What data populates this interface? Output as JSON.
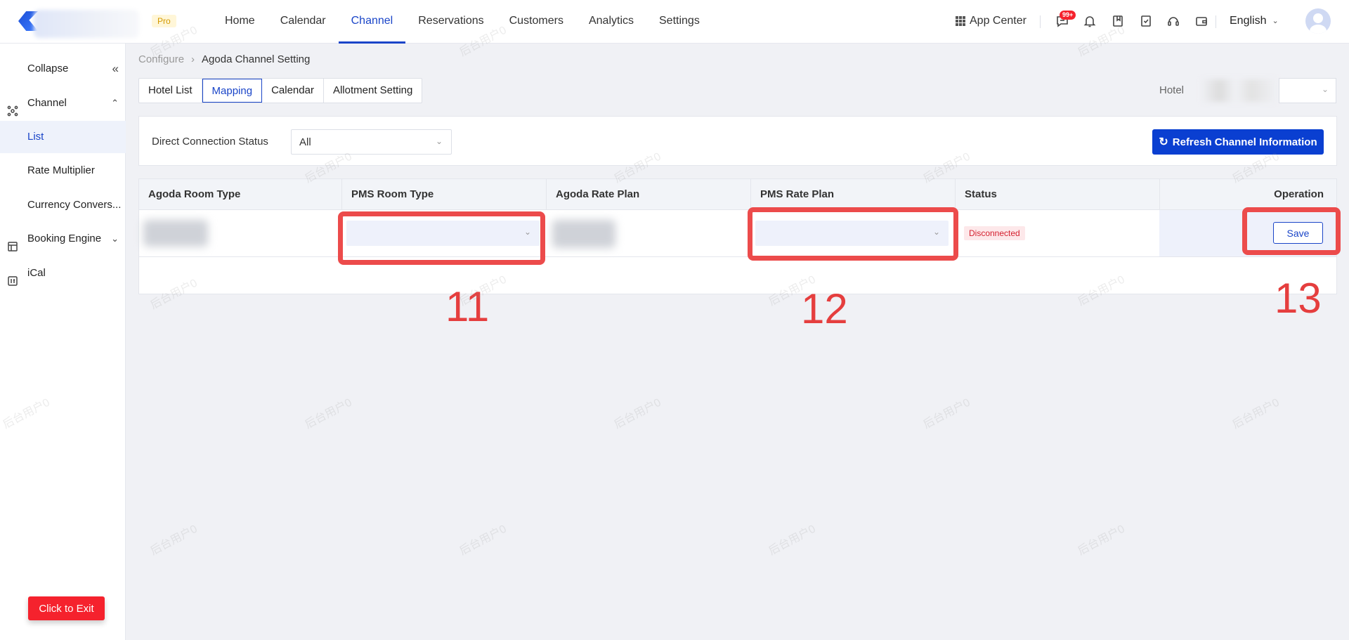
{
  "header": {
    "plan_badge": "Pro",
    "nav": [
      {
        "label": "Home",
        "name": "nav-home",
        "active": false
      },
      {
        "label": "Calendar",
        "name": "nav-calendar",
        "active": false
      },
      {
        "label": "Channel",
        "name": "nav-channel",
        "active": true
      },
      {
        "label": "Reservations",
        "name": "nav-reservations",
        "active": false
      },
      {
        "label": "Customers",
        "name": "nav-customers",
        "active": false
      },
      {
        "label": "Analytics",
        "name": "nav-analytics",
        "active": false
      },
      {
        "label": "Settings",
        "name": "nav-settings",
        "active": false
      }
    ],
    "app_center": "App Center",
    "message_badge": "99+",
    "language": "English"
  },
  "sidebar": {
    "collapse": "Collapse",
    "items": [
      {
        "label": "Channel",
        "icon": "channel-icon"
      },
      {
        "label": "List"
      },
      {
        "label": "Rate Multiplier"
      },
      {
        "label": "Currency Convers..."
      },
      {
        "label": "Booking Engine",
        "icon": "booking-engine-icon"
      },
      {
        "label": "iCal",
        "icon": "ical-icon"
      }
    ],
    "exit_button": "Click to Exit"
  },
  "breadcrumb": {
    "parent": "Configure",
    "current": "Agoda Channel Setting"
  },
  "tabs": [
    "Hotel List",
    "Mapping",
    "Calendar",
    "Allotment Setting"
  ],
  "active_tab": "Mapping",
  "hotel_label": "Hotel",
  "filter": {
    "label": "Direct Connection Status",
    "value": "All"
  },
  "refresh_button": "Refresh Channel Information",
  "table": {
    "headers": [
      "Agoda Room Type",
      "PMS Room Type",
      "Agoda Rate Plan",
      "PMS Rate Plan",
      "Status",
      "Operation"
    ],
    "rows": [
      {
        "status": "Disconnected",
        "action": "Save"
      }
    ]
  },
  "annotations": [
    "11",
    "12",
    "13"
  ],
  "watermark": "后台用户0",
  "colors": {
    "accent": "#1a45c8",
    "primary_button": "#0a3fd1",
    "danger": "#f5222d",
    "highlight": "#ec4b4b"
  }
}
